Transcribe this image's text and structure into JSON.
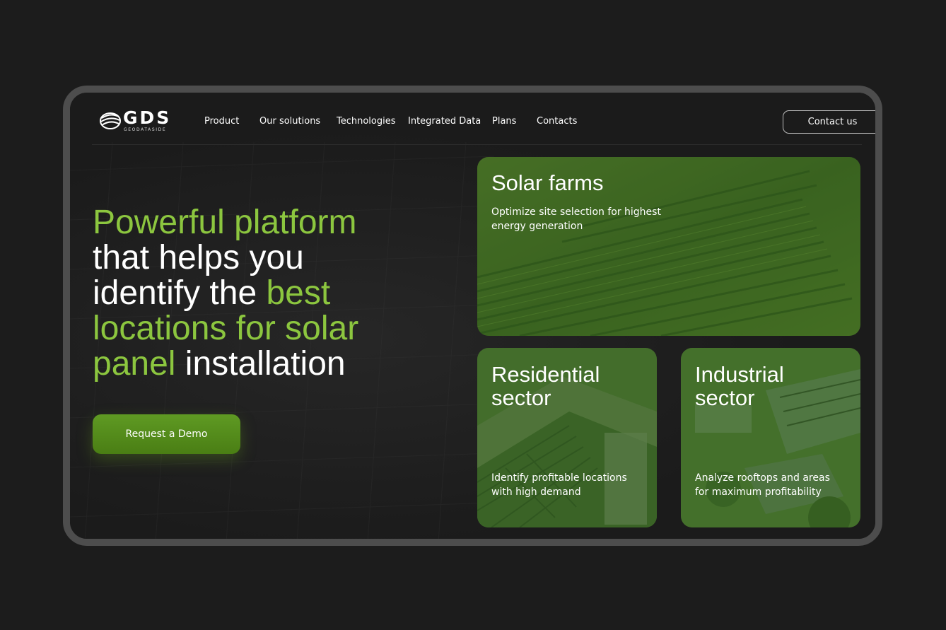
{
  "brand": {
    "name": "GDS",
    "tagline": "GEODATASIDE"
  },
  "nav": {
    "items": [
      {
        "label": "Product"
      },
      {
        "label": "Our solutions"
      },
      {
        "label": "Technologies"
      },
      {
        "label": "Integrated Data"
      },
      {
        "label": "Plans"
      },
      {
        "label": "Contacts"
      }
    ],
    "contact_label": "Contact us"
  },
  "hero": {
    "line1": "Powerful platform",
    "line2": "that helps you",
    "line3a": "identify the ",
    "line3b": "best",
    "line4": "locations for solar",
    "line5a": "panel",
    "line5b": " installation",
    "cta_label": "Request a Demo"
  },
  "cards": [
    {
      "title": "Solar farms",
      "desc_line1": "Optimize site selection for highest",
      "desc_line2": "energy generation"
    },
    {
      "title_line1": "Residential",
      "title_line2": "sector",
      "desc_line1": "Identify profitable locations",
      "desc_line2": "with high demand"
    },
    {
      "title_line1": "Industrial",
      "title_line2": "sector",
      "desc_line1": "Analyze rooftops and areas",
      "desc_line2": "for maximum profitability"
    }
  ],
  "colors": {
    "accent": "#8cc63f",
    "button": "#558b1c",
    "background": "#1c1c1c",
    "frame": "#4d4d4d"
  },
  "icons": {
    "logo": "globe-swirl-icon"
  }
}
